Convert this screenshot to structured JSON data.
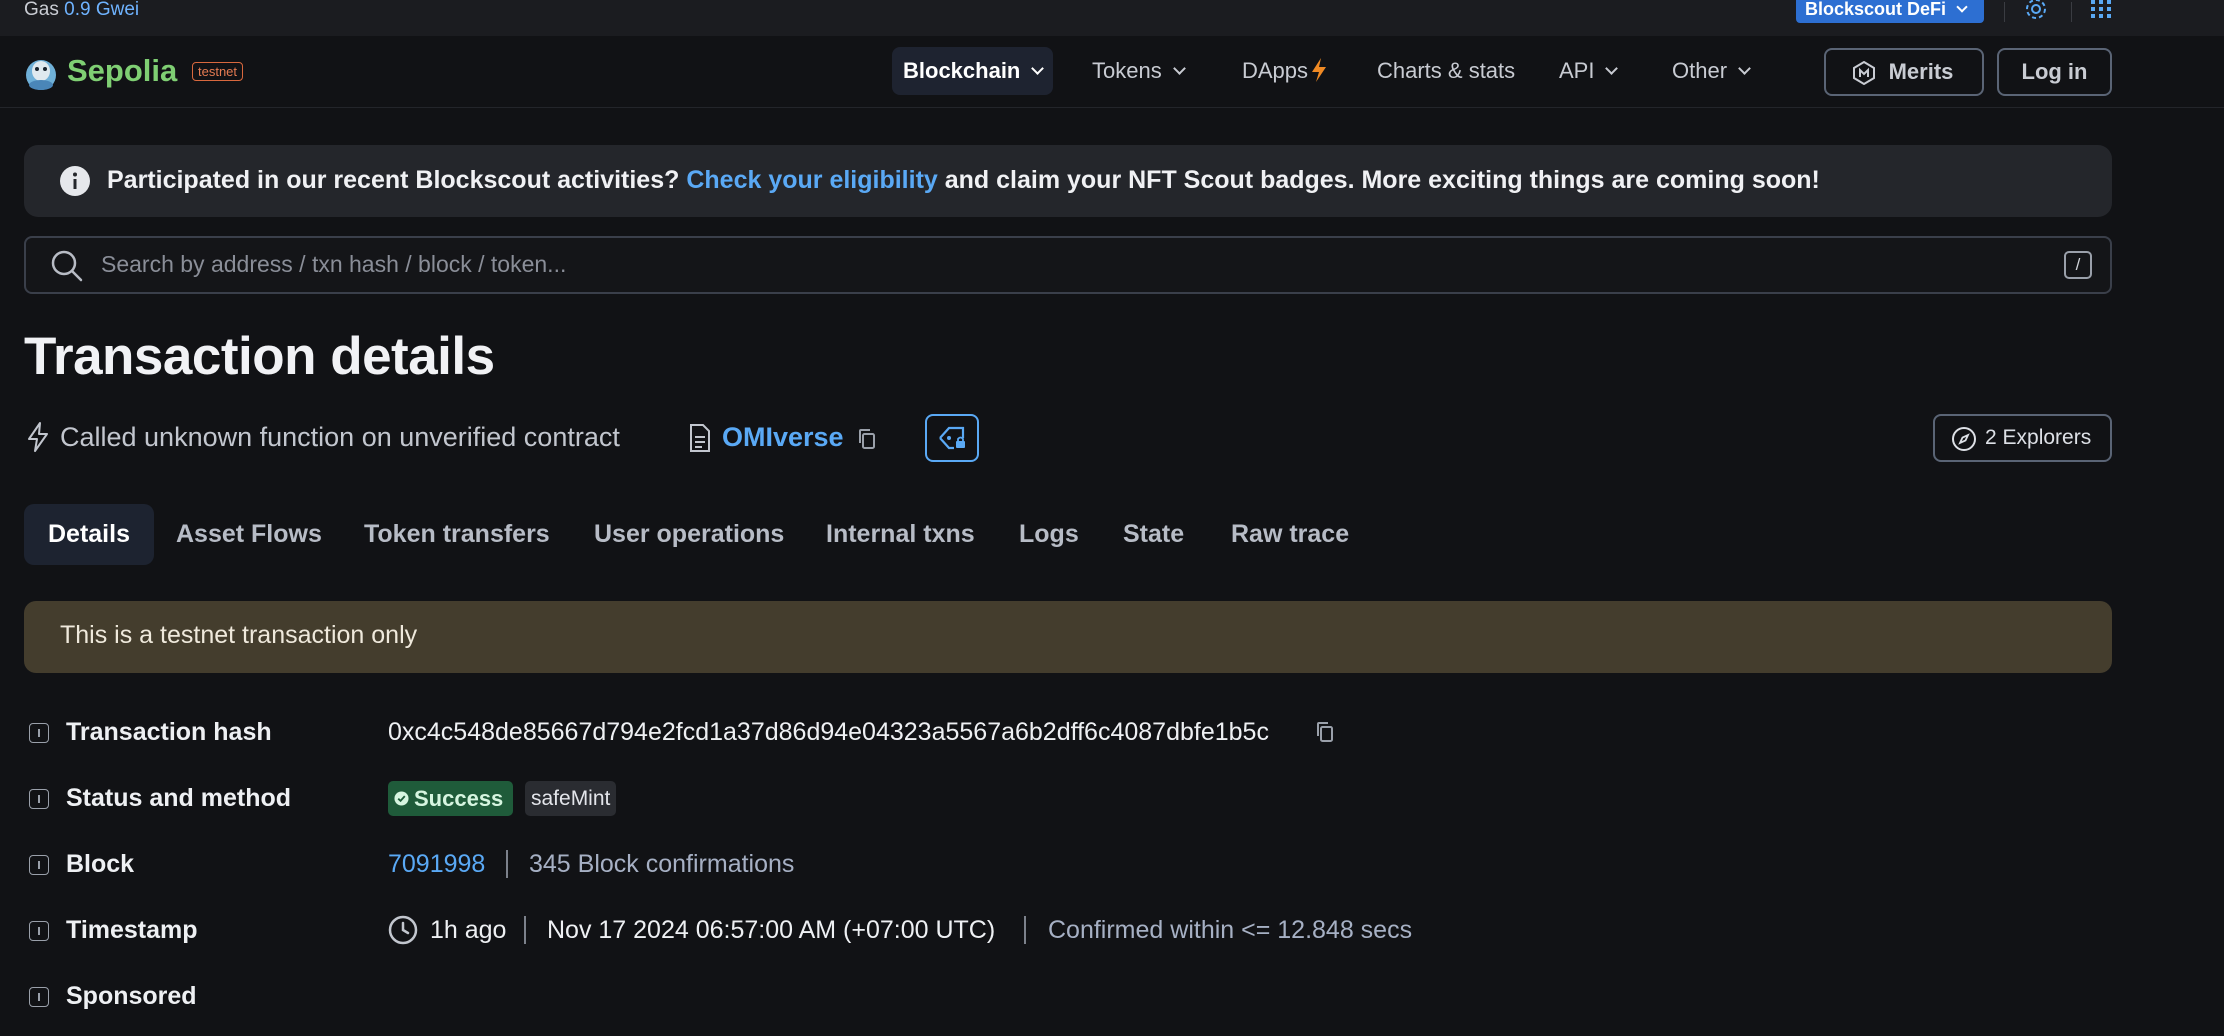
{
  "topbar": {
    "gas_label": "Gas",
    "gas_value": "0.9 Gwei",
    "defi_label": "Blockscout DeFi"
  },
  "header": {
    "brand": "Sepolia",
    "badge": "testnet",
    "nav": [
      {
        "label": "Blockchain"
      },
      {
        "label": "Tokens"
      },
      {
        "label": "DApps"
      },
      {
        "label": "Charts & stats"
      },
      {
        "label": "API"
      },
      {
        "label": "Other"
      }
    ],
    "merits_label": "Merits",
    "login_label": "Log in"
  },
  "banner": {
    "text_before": "Participated in our recent Blockscout activities? ",
    "link": "Check your eligibility",
    "text_after": " and claim your NFT Scout badges. More exciting things are coming soon!"
  },
  "search": {
    "placeholder": "Search by address / txn hash / block / token...",
    "shortcut": "/"
  },
  "page": {
    "title": "Transaction details",
    "subtitle": "Called unknown function on unverified contract",
    "contract": "OMIverse",
    "explorers": "2 Explorers"
  },
  "tabs": [
    {
      "label": "Details"
    },
    {
      "label": "Asset Flows"
    },
    {
      "label": "Token transfers"
    },
    {
      "label": "User operations"
    },
    {
      "label": "Internal txns"
    },
    {
      "label": "Logs"
    },
    {
      "label": "State"
    },
    {
      "label": "Raw trace"
    }
  ],
  "notice": "This is a testnet transaction only",
  "details": {
    "hash_label": "Transaction hash",
    "hash_value": "0xc4c548de85667d794e2fcd1a37d86d94e04323a5567a6b2dff6c4087dbfe1b5c",
    "status_label": "Status and method",
    "status_value": "Success",
    "method_value": "safeMint",
    "block_label": "Block",
    "block_value": "7091998",
    "confirmations": "345 Block confirmations",
    "timestamp_label": "Timestamp",
    "time_ago": "1h ago",
    "time_full": "Nov 17 2024 06:57:00 AM (+07:00 UTC)",
    "confirmed_within": "Confirmed within <= 12.848 secs",
    "sponsored_label": "Sponsored"
  },
  "colors": {
    "background": "#111215",
    "accent": "#5aa9f5",
    "brand": "#7fcf73",
    "success": "#1f5b3a"
  }
}
